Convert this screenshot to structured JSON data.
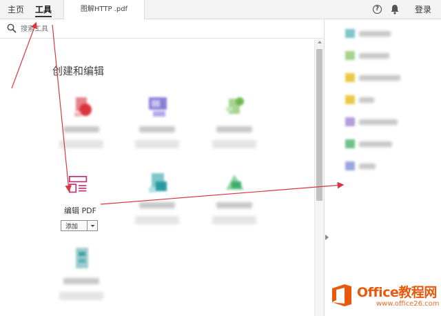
{
  "topbar": {
    "home_label": "主页",
    "tools_label": "工具",
    "doc_tab_label": "图解HTTP .pdf",
    "login_label": "登录"
  },
  "search": {
    "placeholder": "搜索工具"
  },
  "section": {
    "title": "创建和编辑"
  },
  "tools": {
    "edit_pdf_label": "编辑 PDF",
    "add_button_label": "添加"
  },
  "watermark": {
    "brand": "Office教程网",
    "site": "www.office26.com"
  },
  "colors": {
    "accent_red": "#d9363e",
    "brand_orange": "#e8590c",
    "edit_icon_pink": "#c0307a"
  },
  "icons": {
    "help": "help-icon",
    "bell": "bell-icon",
    "search": "search-icon"
  }
}
